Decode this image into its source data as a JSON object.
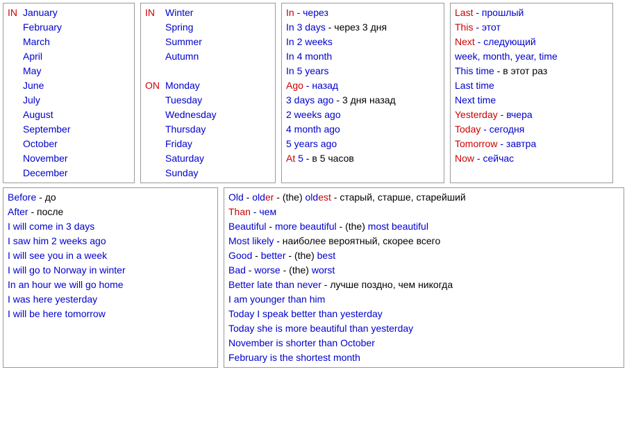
{
  "box1": {
    "prep": "IN",
    "items": [
      "January",
      "February",
      "March",
      "April",
      "May",
      "June",
      "July",
      "August",
      "September",
      "October",
      "November",
      "December"
    ]
  },
  "box2": {
    "groups": [
      {
        "prep": "IN",
        "items": [
          "Winter",
          "Spring",
          "Summer",
          "Autumn"
        ]
      },
      {
        "prep": "ON",
        "items": [
          "Monday",
          "Tuesday",
          "Wednesday",
          "Thursday",
          "Friday",
          "Saturday",
          "Sunday"
        ]
      }
    ]
  },
  "box3": {
    "lines": [
      [
        {
          "t": "In",
          "c": "red"
        },
        {
          "t": " - через",
          "c": "blue"
        }
      ],
      [
        {
          "t": "In 3 days",
          "c": "blue"
        },
        {
          "t": " - через 3 дня",
          "c": "black"
        }
      ],
      [
        {
          "t": "In 2 weeks",
          "c": "blue"
        }
      ],
      [
        {
          "t": "In 4 month",
          "c": "blue"
        }
      ],
      [
        {
          "t": "In 5 years",
          "c": "blue"
        }
      ],
      [
        {
          "t": "Ago",
          "c": "red"
        },
        {
          "t": " - назад",
          "c": "blue"
        }
      ],
      [
        {
          "t": "3 days ago",
          "c": "blue"
        },
        {
          "t": " - 3 дня назад",
          "c": "black"
        }
      ],
      [
        {
          "t": "2 weeks ago",
          "c": "blue"
        }
      ],
      [
        {
          "t": "4 month ago",
          "c": "blue"
        }
      ],
      [
        {
          "t": "5 years ago",
          "c": "blue"
        }
      ],
      [
        {
          "t": "At",
          "c": "red"
        },
        {
          "t": " 5",
          "c": "blue"
        },
        {
          "t": " - в 5 часов",
          "c": "black"
        }
      ]
    ]
  },
  "box4": {
    "lines": [
      [
        {
          "t": "Last",
          "c": "red"
        },
        {
          "t": " - прошлый",
          "c": "blue"
        }
      ],
      [
        {
          "t": "This",
          "c": "red"
        },
        {
          "t": " - этот",
          "c": "blue"
        }
      ],
      [
        {
          "t": "Next",
          "c": "red"
        },
        {
          "t": " - следующий",
          "c": "blue"
        }
      ],
      [
        {
          "t": "week, month, year, time",
          "c": "blue"
        }
      ],
      [
        {
          "t": "This time",
          "c": "blue"
        },
        {
          "t": " - в этот раз",
          "c": "black"
        }
      ],
      [
        {
          "t": "Last time",
          "c": "blue"
        }
      ],
      [
        {
          "t": "Next time",
          "c": "blue"
        }
      ],
      [
        {
          "t": "Yesterday",
          "c": "red"
        },
        {
          "t": " - вчера",
          "c": "blue"
        }
      ],
      [
        {
          "t": "Today",
          "c": "red"
        },
        {
          "t": " - сегодня",
          "c": "blue"
        }
      ],
      [
        {
          "t": "Tomorrow",
          "c": "red"
        },
        {
          "t": " - завтра",
          "c": "blue"
        }
      ],
      [
        {
          "t": "Now",
          "c": "red"
        },
        {
          "t": " - сейчас",
          "c": "blue"
        }
      ]
    ]
  },
  "box5": {
    "lines": [
      [
        {
          "t": "Before",
          "c": "blue"
        },
        {
          "t": " - до",
          "c": "black"
        }
      ],
      [
        {
          "t": "After",
          "c": "blue"
        },
        {
          "t": " - после",
          "c": "black"
        }
      ],
      [
        {
          "t": "I will come in 3 days",
          "c": "blue"
        }
      ],
      [
        {
          "t": "I saw him 2 weeks ago",
          "c": "blue"
        }
      ],
      [
        {
          "t": "I will see you in a week",
          "c": "blue"
        }
      ],
      [
        {
          "t": "I will go to Norway in winter",
          "c": "blue"
        }
      ],
      [
        {
          "t": "In an hour we will go home",
          "c": "blue"
        }
      ],
      [
        {
          "t": "I was here yesterday",
          "c": "blue"
        }
      ],
      [
        {
          "t": "I will be here tomorrow",
          "c": "blue"
        }
      ]
    ]
  },
  "box6": {
    "lines": [
      [
        {
          "t": "Old",
          "c": "blue"
        },
        {
          "t": " - ",
          "c": "black"
        },
        {
          "t": "old",
          "c": "blue"
        },
        {
          "t": "er",
          "c": "red"
        },
        {
          "t": " - (the) ",
          "c": "black"
        },
        {
          "t": "old",
          "c": "blue"
        },
        {
          "t": "est",
          "c": "red"
        },
        {
          "t": " - старый, старше, старейший",
          "c": "black"
        }
      ],
      [
        {
          "t": "Than",
          "c": "red"
        },
        {
          "t": " - чем",
          "c": "blue"
        }
      ],
      [
        {
          "t": "Beautiful",
          "c": "blue"
        },
        {
          "t": " - ",
          "c": "black"
        },
        {
          "t": "more beautiful",
          "c": "blue"
        },
        {
          "t": " - (the) ",
          "c": "black"
        },
        {
          "t": "most beautiful",
          "c": "blue"
        }
      ],
      [
        {
          "t": "Most likely",
          "c": "blue"
        },
        {
          "t": " - наиболее вероятный, скорее всего",
          "c": "black"
        }
      ],
      [
        {
          "t": "Good",
          "c": "blue"
        },
        {
          "t": " - ",
          "c": "black"
        },
        {
          "t": "better",
          "c": "blue"
        },
        {
          "t": " - (the) ",
          "c": "black"
        },
        {
          "t": "best",
          "c": "blue"
        }
      ],
      [
        {
          "t": "Bad",
          "c": "blue"
        },
        {
          "t": " - ",
          "c": "black"
        },
        {
          "t": "worse",
          "c": "blue"
        },
        {
          "t": " - (the) ",
          "c": "black"
        },
        {
          "t": "worst",
          "c": "blue"
        }
      ],
      [
        {
          "t": "Better late than never",
          "c": "blue"
        },
        {
          "t": " - лучше поздно, чем никогда",
          "c": "black"
        }
      ],
      [
        {
          "t": "I am younger than him",
          "c": "blue"
        }
      ],
      [
        {
          "t": "Today I speak better than yesterday",
          "c": "blue"
        }
      ],
      [
        {
          "t": "Today she is more beautiful than yesterday",
          "c": "blue"
        }
      ],
      [
        {
          "t": "November is shorter than October",
          "c": "blue"
        }
      ],
      [
        {
          "t": "February is the shortest month",
          "c": "blue"
        }
      ]
    ]
  }
}
